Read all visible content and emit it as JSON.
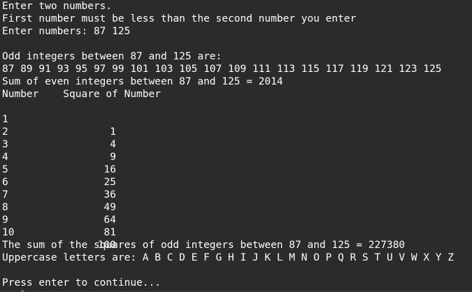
{
  "terminal": {
    "lines": [
      "Enter two numbers.",
      "First number must be less than the second number you enter",
      "Enter numbers: 87 125",
      "",
      "Odd integers between 87 and 125 are:",
      "87 89 91 93 95 97 99 101 103 105 107 109 111 113 115 117 119 121 123 125",
      "Sum of even integers between 87 and 125 = 2014",
      "Number    Square of Number"
    ],
    "table": [
      {
        "number": "1",
        "square": "1"
      },
      {
        "number": "2",
        "square": "4"
      },
      {
        "number": "3",
        "square": "9"
      },
      {
        "number": "4",
        "square": "16"
      },
      {
        "number": "5",
        "square": "25"
      },
      {
        "number": "6",
        "square": "36"
      },
      {
        "number": "7",
        "square": "49"
      },
      {
        "number": "8",
        "square": "64"
      },
      {
        "number": "9",
        "square": "81"
      },
      {
        "number": "10",
        "square": "100"
      }
    ],
    "after_lines": [
      "",
      "The sum of the squares of odd integers between 87 and 125 = 227380",
      "Uppercase letters are: A B C D E F G H I J K L M N O P Q R S T U V W X Y Z",
      "",
      "Press enter to continue..."
    ]
  }
}
